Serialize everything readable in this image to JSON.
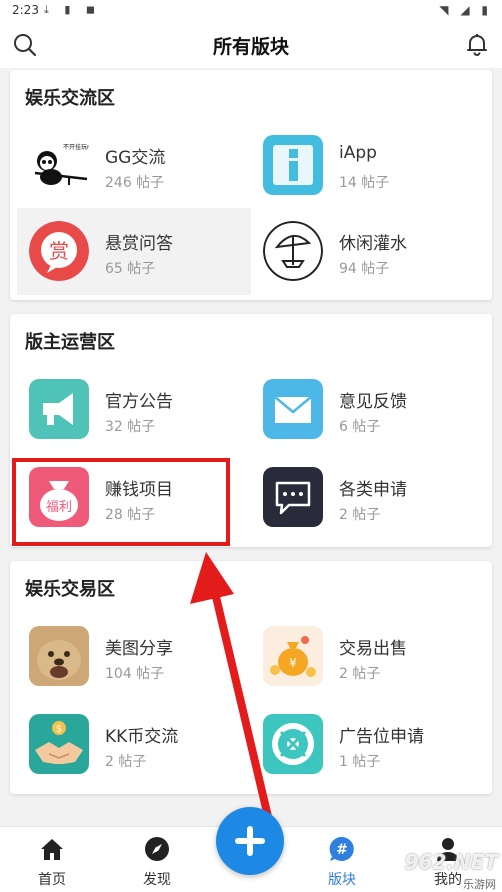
{
  "status_bar": {
    "time": "2:23"
  },
  "header": {
    "title": "所有版块"
  },
  "sections": [
    {
      "title": "娱乐交流区",
      "items": [
        {
          "name": "GG交流",
          "count": "246 帖子",
          "icon": "panda-sniper-icon",
          "icon_text": "不开挂玩nm游戏"
        },
        {
          "name": "iApp",
          "count": "14 帖子",
          "icon": "iapp-icon"
        },
        {
          "name": "悬赏问答",
          "count": "65 帖子",
          "icon": "reward-badge-icon",
          "icon_text": "赏"
        },
        {
          "name": "休闲灌水",
          "count": "94 帖子",
          "icon": "beach-umbrella-icon"
        }
      ]
    },
    {
      "title": "版主运营区",
      "items": [
        {
          "name": "官方公告",
          "count": "32 帖子",
          "icon": "megaphone-icon"
        },
        {
          "name": "意见反馈",
          "count": "6 帖子",
          "icon": "envelope-icon"
        },
        {
          "name": "赚钱项目",
          "count": "28 帖子",
          "icon": "lucky-bag-icon",
          "icon_text": "福利"
        },
        {
          "name": "各类申请",
          "count": "2 帖子",
          "icon": "chat-bubble-icon"
        }
      ]
    },
    {
      "title": "娱乐交易区",
      "items": [
        {
          "name": "美图分享",
          "count": "104 帖子",
          "icon": "dog-photo-icon"
        },
        {
          "name": "交易出售",
          "count": "2 帖子",
          "icon": "money-bag-icon"
        },
        {
          "name": "KK币交流",
          "count": "2 帖子",
          "icon": "handshake-coin-icon"
        },
        {
          "name": "广告位申请",
          "count": "1 帖子",
          "icon": "lifebuoy-icon"
        }
      ]
    }
  ],
  "bottom_nav": [
    {
      "label": "首页",
      "icon": "home-icon"
    },
    {
      "label": "发现",
      "icon": "compass-icon"
    },
    {
      "label": "版块",
      "icon": "hashtag-icon",
      "active": true
    },
    {
      "label": "我的",
      "icon": "profile-icon"
    }
  ],
  "watermark": {
    "logo": "962.NET",
    "text": "乐游网"
  },
  "colors": {
    "accent": "#1e88e5",
    "active_tab": "#2f7fe0",
    "annotation_red": "#e41b1b"
  }
}
